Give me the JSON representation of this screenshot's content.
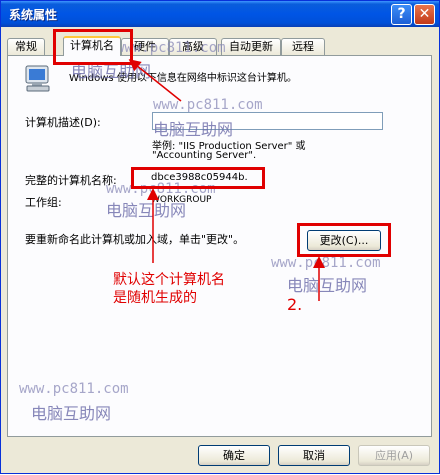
{
  "window": {
    "title": "系统属性",
    "help_glyph": "?",
    "close_glyph": "✕"
  },
  "tabs": [
    {
      "label": "常规"
    },
    {
      "label": "计算机名",
      "active": true
    },
    {
      "label": "硬件"
    },
    {
      "label": "高级"
    },
    {
      "label": "自动更新"
    },
    {
      "label": "远程"
    }
  ],
  "content": {
    "intro": "Windows 使用以下信息在网络中标识这台计算机。",
    "description_label": "计算机描述(D):",
    "description_value": "",
    "example_line1": "举例: \"IIS Production Server\" 或",
    "example_line2": "\"Accounting Server\".",
    "fullname_label": "完整的计算机名称:",
    "fullname_value": "dbce3988c05944b.",
    "workgroup_label": "工作组:",
    "workgroup_value": "WORKGROUP",
    "rename_text": "要重新命名此计算机或加入域，单击\"更改\"。",
    "change_button": "更改(C)..."
  },
  "footer": {
    "ok": "确定",
    "cancel": "取消",
    "apply": "应用(A)"
  },
  "annotations": {
    "note_line1": "默认这个计算机名",
    "note_line2": "是随机生成的",
    "step": "2."
  },
  "watermarks": {
    "url": "www.pc811.com",
    "name": "电脑互助网"
  },
  "colors": {
    "highlight": "#e00000",
    "titlebar": "#0055e5"
  },
  "icons": {
    "computer": "computer-icon",
    "help": "help-icon",
    "close": "close-icon"
  }
}
